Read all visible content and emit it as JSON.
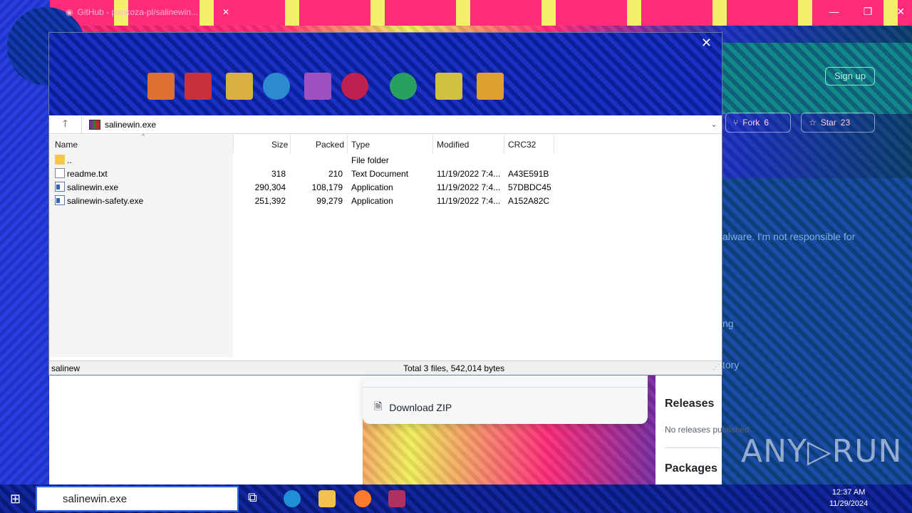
{
  "browser": {
    "tab_title": "GitHub - pankoza-pl/salinewin...",
    "tab_close": "✕",
    "window_controls": [
      "—",
      "❐",
      "✕"
    ],
    "signup_label": "Sign up",
    "fork_label": "Fork",
    "fork_count": "6",
    "star_label": "Star",
    "star_count": "23",
    "about_fragment": "alware. I'm not responsible for",
    "ng_fragment": "ng",
    "tory_fragment": "tory"
  },
  "download_menu": {
    "item_label": "Download ZIP"
  },
  "sidebar": {
    "releases_title": "Releases",
    "releases_sub": "No releases published",
    "packages_title": "Packages"
  },
  "winrar": {
    "close": "✕",
    "up_button": "🡑",
    "address": "salinewin.exe",
    "columns": [
      "Name",
      "Size",
      "Packed",
      "Type",
      "Modified",
      "CRC32"
    ],
    "rows": [
      {
        "name": "..",
        "size": "",
        "packed": "",
        "type": "File folder",
        "modified": "",
        "crc": "",
        "icon": "folder-icon"
      },
      {
        "name": "readme.txt",
        "size": "318",
        "packed": "210",
        "type": "Text Document",
        "modified": "11/19/2022 7:4...",
        "crc": "A43E591B",
        "icon": "text-file-icon"
      },
      {
        "name": "salinewin.exe",
        "size": "290,304",
        "packed": "108,179",
        "type": "Application",
        "modified": "11/19/2022 7:4...",
        "crc": "57DBDC45",
        "icon": "exe-file-icon"
      },
      {
        "name": "salinewin-safety.exe",
        "size": "251,392",
        "packed": "99,279",
        "type": "Application",
        "modified": "11/19/2022 7:4...",
        "crc": "A152A82C",
        "icon": "exe-file-icon"
      }
    ],
    "status_left": "salinew",
    "status_total": "Total 3 files, 542,014 bytes"
  },
  "taskbar": {
    "search_text": "salinewin.exe",
    "clock_time": "12:37 AM",
    "clock_date": "11/29/2024"
  },
  "watermark": "ANY▷RUN",
  "colors": {
    "toolbar_blue": "#1a32c4",
    "accent_pink": "#ff2c7a"
  }
}
